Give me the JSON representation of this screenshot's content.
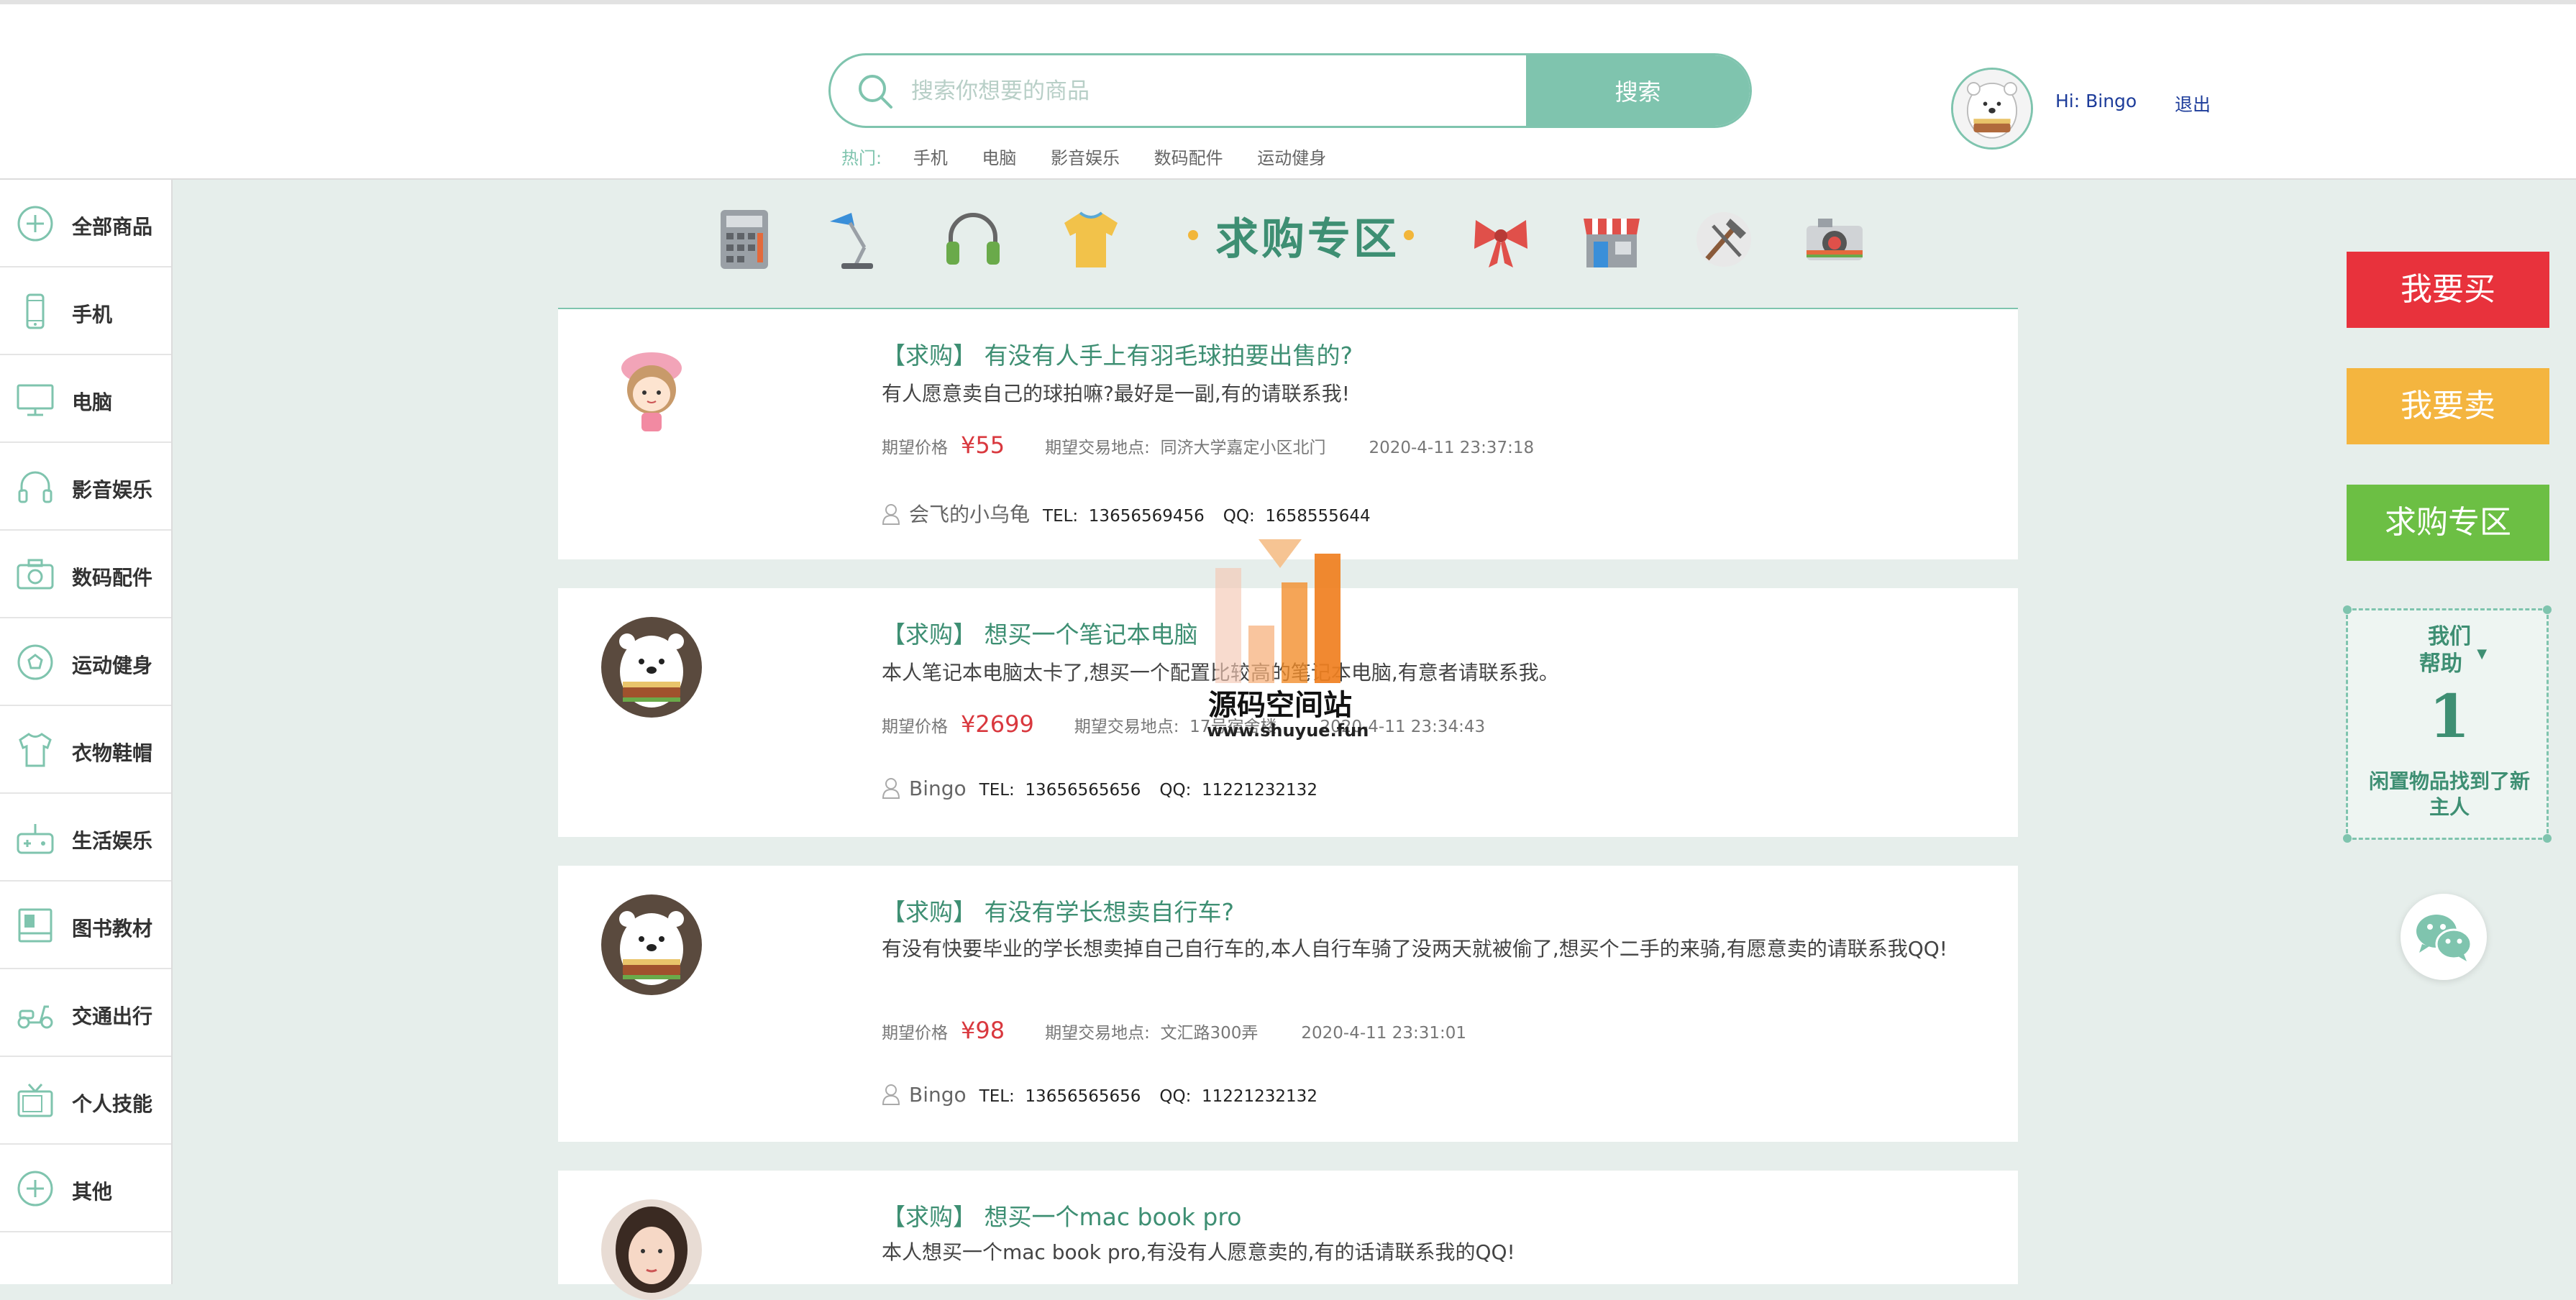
{
  "header": {
    "search_placeholder": "搜索你想要的商品",
    "search_button": "搜索",
    "hot_label": "热门:",
    "hot_links": [
      "手机",
      "电脑",
      "影音娱乐",
      "数码配件",
      "运动健身"
    ],
    "greeting": "Hi:  Bingo",
    "logout": "退出"
  },
  "sidebar": {
    "items": [
      {
        "label": "全部商品",
        "icon": "plus-circle-icon"
      },
      {
        "label": "手机",
        "icon": "phone-icon"
      },
      {
        "label": "电脑",
        "icon": "monitor-icon"
      },
      {
        "label": "影音娱乐",
        "icon": "headphones-icon"
      },
      {
        "label": "数码配件",
        "icon": "camera-icon"
      },
      {
        "label": "运动健身",
        "icon": "football-icon"
      },
      {
        "label": "衣物鞋帽",
        "icon": "shirt-icon"
      },
      {
        "label": "生活娱乐",
        "icon": "gamepad-icon"
      },
      {
        "label": "图书教材",
        "icon": "book-icon"
      },
      {
        "label": "交通出行",
        "icon": "scooter-icon"
      },
      {
        "label": "个人技能",
        "icon": "tv-icon"
      },
      {
        "label": "其他",
        "icon": "plus-circle-icon"
      }
    ]
  },
  "banner": {
    "title": "求购专区",
    "icons": [
      "calculator-icon",
      "desk-lamp-icon",
      "headphones-icon",
      "tshirt-icon",
      "bow-icon",
      "shop-icon",
      "tools-icon",
      "camera-icon"
    ]
  },
  "labels": {
    "price": "期望价格",
    "location": "期望交易地点:",
    "tel": "TEL:",
    "qq": "QQ:"
  },
  "requests": [
    {
      "title": "【求购】 有没有人手上有羽毛球拍要出售的?",
      "desc": "有人愿意卖自己的球拍嘛?最好是一副,有的请联系我!",
      "price": "¥55",
      "location": "同济大学嘉定小区北门",
      "time": "2020-4-11 23:37:18",
      "user": "会飞的小乌龟",
      "tel": "13656569456",
      "qq": "1658555644",
      "avatar": "girl-avatar-icon"
    },
    {
      "title": "【求购】 想买一个笔记本电脑",
      "desc": "本人笔记本电脑太卡了,想买一个配置比较高的笔记本电脑,有意者请联系我。",
      "price": "¥2699",
      "location": "17号宿舍楼",
      "time": "2020-4-11 23:34:43",
      "user": "Bingo",
      "tel": "13656565656",
      "qq": "11221232132",
      "avatar": "bear-avatar-icon"
    },
    {
      "title": "【求购】 有没有学长想卖自行车?",
      "desc": "有没有快要毕业的学长想卖掉自己自行车的,本人自行车骑了没两天就被偷了,想买个二手的来骑,有愿意卖的请联系我QQ!",
      "price": "¥98",
      "location": "文汇路300弄",
      "time": "2020-4-11 23:31:01",
      "user": "Bingo",
      "tel": "13656565656",
      "qq": "11221232132",
      "avatar": "bear-avatar-icon"
    },
    {
      "title": "【求购】 想买一个mac book pro",
      "desc": "本人想买一个mac book pro,有没有人愿意卖的,有的话请联系我的QQ!",
      "avatar": "woman-avatar-icon"
    }
  ],
  "right_panel": {
    "buy_button": "我要买",
    "sell_button": "我要卖",
    "request_button": "求购专区",
    "help_title_1": "我们",
    "help_title_2": "帮助",
    "help_count": "1",
    "help_desc": "闲置物品找到了新主人"
  },
  "watermark": {
    "name": "源码空间站",
    "url": "www.shuyue.fun"
  },
  "colors": {
    "accent": "#7fc4ae",
    "dark_green": "#3e8f73",
    "price": "#d9383e",
    "buy": "#e8323c",
    "sell": "#f4b53f",
    "request": "#6cbf44"
  }
}
